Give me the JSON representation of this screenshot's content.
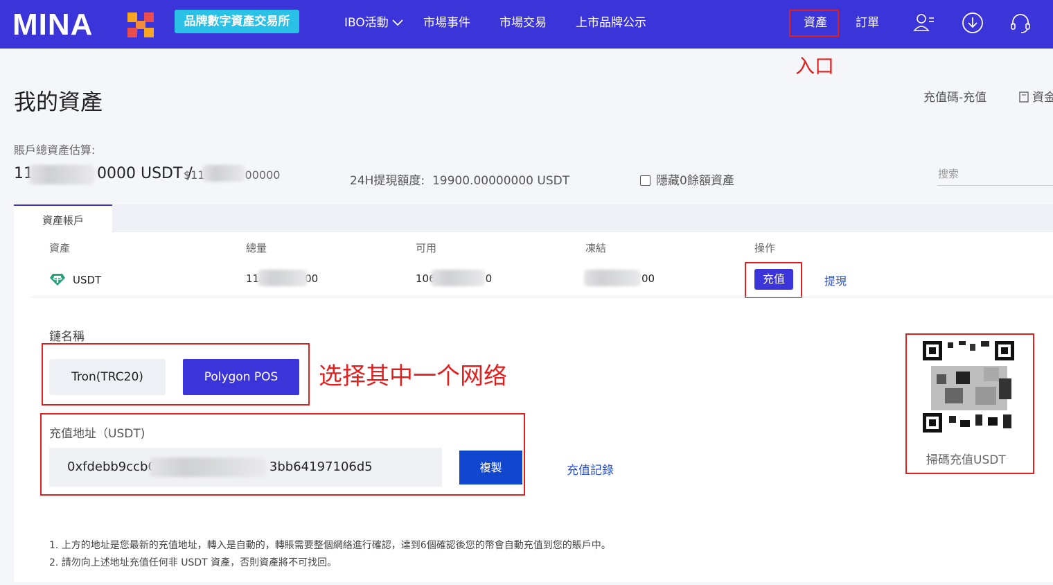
{
  "nav": {
    "logo_text": "MINA",
    "badge": "品牌數字資產交易所",
    "items": [
      "IBO活動",
      "市場事件",
      "市場交易",
      "上市品牌公示"
    ],
    "assets": "資產",
    "orders": "訂單"
  },
  "annotations": {
    "entry": "入口",
    "choose_network": "选择其中一个网络"
  },
  "page": {
    "title": "我的資產",
    "recharge_code": "充值碼-充值",
    "asset_link": "資金"
  },
  "summary": {
    "label": "賬戶總資產估算:",
    "total_prefix": "11",
    "total_suffix": "0000 USDT /",
    "fiat_prefix": "$11",
    "fiat_suffix": "00000",
    "limit_label": "24H提現額度:",
    "limit_value": "19900.00000000 USDT",
    "hide_zero": "隱藏0餘額資產",
    "search_placeholder": "搜索"
  },
  "tabs": {
    "active": "資產帳戶"
  },
  "table": {
    "headers": [
      "資產",
      "總量",
      "可用",
      "凍結",
      "操作"
    ],
    "row": {
      "asset": "USDT",
      "total_prefix": "11",
      "total_suffix": "00",
      "available_prefix": "106",
      "available_suffix": "0",
      "frozen_suffix": "00",
      "recharge": "充值",
      "withdraw": "提現"
    }
  },
  "deposit": {
    "chain_label": "鏈名稱",
    "chains": [
      "Tron(TRC20)",
      "Polygon POS"
    ],
    "address_label": "充值地址（USDT)",
    "address_prefix": "0xfdebb9ccb0",
    "address_suffix": "3bb64197106d5",
    "copy": "複製",
    "history": "充值記錄",
    "qr_caption": "掃碼充值USDT"
  },
  "notes": [
    "1. 上方的地址是您最新的充值地址，轉入是自動的，轉賬需要整個網絡進行確認，達到6個確認後您的幣會自動充值到您的賬戶中。",
    "2. 請勿向上述地址充值任何非 USDT 資產，否則資產將不可找回。"
  ],
  "colors": {
    "nav_bg": "#3b34d9",
    "badge": "#29c1e6",
    "annotation_red": "#e0201f",
    "link": "#2f53d5",
    "copy_button": "#1147cf"
  }
}
